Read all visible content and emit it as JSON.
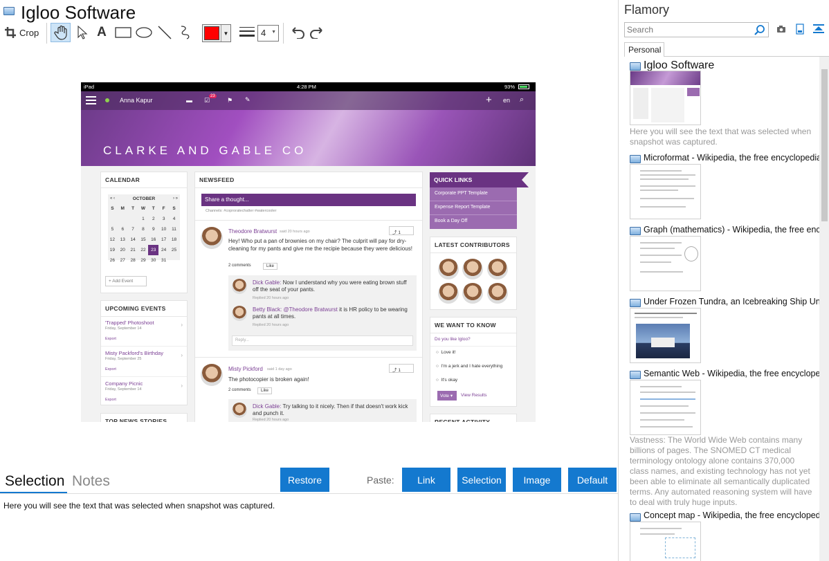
{
  "window": {
    "title": "Igloo Software"
  },
  "toolbar": {
    "crop_label": "Crop",
    "line_width_value": "4",
    "color": "#ff0000"
  },
  "embedded": {
    "status_left": "iPad",
    "status_time": "4:28 PM",
    "status_battery": "93%",
    "user_name": "Anna Kapur",
    "notif_count": "23",
    "lang": "en",
    "banner_title": "CLARKE AND GABLE CO",
    "calendar": {
      "header": "CALENDAR",
      "month": "OCTOBER",
      "weekdays": [
        "S",
        "M",
        "T",
        "W",
        "T",
        "F",
        "S"
      ],
      "weeks": [
        [
          "",
          "",
          "",
          "1",
          "2",
          "3",
          "4"
        ],
        [
          "5",
          "6",
          "7",
          "8",
          "9",
          "10",
          "11"
        ],
        [
          "12",
          "13",
          "14",
          "15",
          "16",
          "17",
          "18"
        ],
        [
          "19",
          "20",
          "21",
          "22",
          "23",
          "24",
          "25"
        ],
        [
          "26",
          "27",
          "28",
          "29",
          "30",
          "31",
          ""
        ]
      ],
      "add_event": "+ Add Event"
    },
    "upcoming": {
      "header": "UPCOMING EVENTS",
      "items": [
        {
          "title": "'Trapped' Photoshoot",
          "date": "Friday, September 14",
          "action": "Export"
        },
        {
          "title": "Misty Packford's Birthday",
          "date": "Friday, September 25",
          "action": "Export"
        },
        {
          "title": "Company Picnic",
          "date": "Friday, September 14",
          "action": "Export"
        }
      ],
      "next_header": "TOP NEWS STORIES"
    },
    "newsfeed": {
      "header": "NEWSFEED",
      "share_placeholder": "Share a thought...",
      "channels": "Channels: #coproratechatter #watercooler",
      "posts": [
        {
          "author": "Theodore Bratwurst",
          "time": "said 20 hours ago",
          "text": "Hey! Who put a pan of brownies on my chair? The culprit will pay for dry-cleaning for my pants and give me the recipie because they were delicious!",
          "comments": "2 comments",
          "like": "Like",
          "share_count": "1"
        },
        {
          "author": "Misty Pickford",
          "time": "said 1 day ago",
          "text": "The photocopier is broken again!",
          "comments": "2 comments",
          "like": "Like",
          "share_count": "1"
        }
      ],
      "replies": [
        {
          "author": "Dick Gable:",
          "text": "Now I understand why you were eating brown stuff off the seat of your pants.",
          "time": "Replied 20 hours ago"
        },
        {
          "author": "Betty Black:",
          "mention": "@Theodore Bratwurst",
          "text": "it is HR policy to be wearing pants at all times.",
          "time": "Replied 20 hours ago"
        },
        {
          "author": "Dick Gable:",
          "text": "Try talking to it nicely. Then if that doesn't work kick and punch it.",
          "time": "Replied 20 hours ago"
        }
      ],
      "reply_placeholder": "Reply..."
    },
    "quick_links": {
      "header": "QUICK LINKS",
      "items": [
        "Corporate PPT Template",
        "Expense Report Template",
        "Book a Day Off"
      ]
    },
    "contributors": {
      "header": "LATEST CONTRIBUTORS"
    },
    "poll": {
      "header": "WE WANT TO KNOW",
      "question": "Do you like Igloo?",
      "options": [
        "Love it!",
        "I'm a jerk and I hate everything",
        "It's okay"
      ],
      "vote": "Vote",
      "results": "View Results"
    },
    "recent_header": "RECENT ACTIVITY"
  },
  "bottom": {
    "tab_selection": "Selection",
    "tab_notes": "Notes",
    "restore": "Restore",
    "paste_label": "Paste:",
    "paste_link": "Link",
    "paste_selection": "Selection",
    "paste_image": "Image",
    "paste_default": "Default",
    "selection_text": "Here you will see the text that was selected when snapshot was captured."
  },
  "sidebar": {
    "app_name": "Flamory",
    "search_placeholder": "Search",
    "tab_personal": "Personal",
    "entries": [
      {
        "title": "Igloo Software",
        "snippet": "Here you will see the text that was selected when snapshot was captured."
      },
      {
        "title": "Microformat - Wikipedia, the free encyclopedia"
      },
      {
        "title": "Graph (mathematics) - Wikipedia, the free ency"
      },
      {
        "title": "Under Frozen Tundra, an Icebreaking Ship Unco"
      },
      {
        "title": "Semantic Web - Wikipedia, the free encycloped",
        "snippet": "Vastness: The World Wide Web contains many billions of pages. The SNOMED CT medical terminology ontology alone contains 370,000 class names, and existing technology has not yet been able to eliminate all semantically duplicated terms. Any automated reasoning system will have to deal with truly huge inputs."
      },
      {
        "title": "Concept map - Wikipedia, the free encyclopedia"
      }
    ]
  }
}
